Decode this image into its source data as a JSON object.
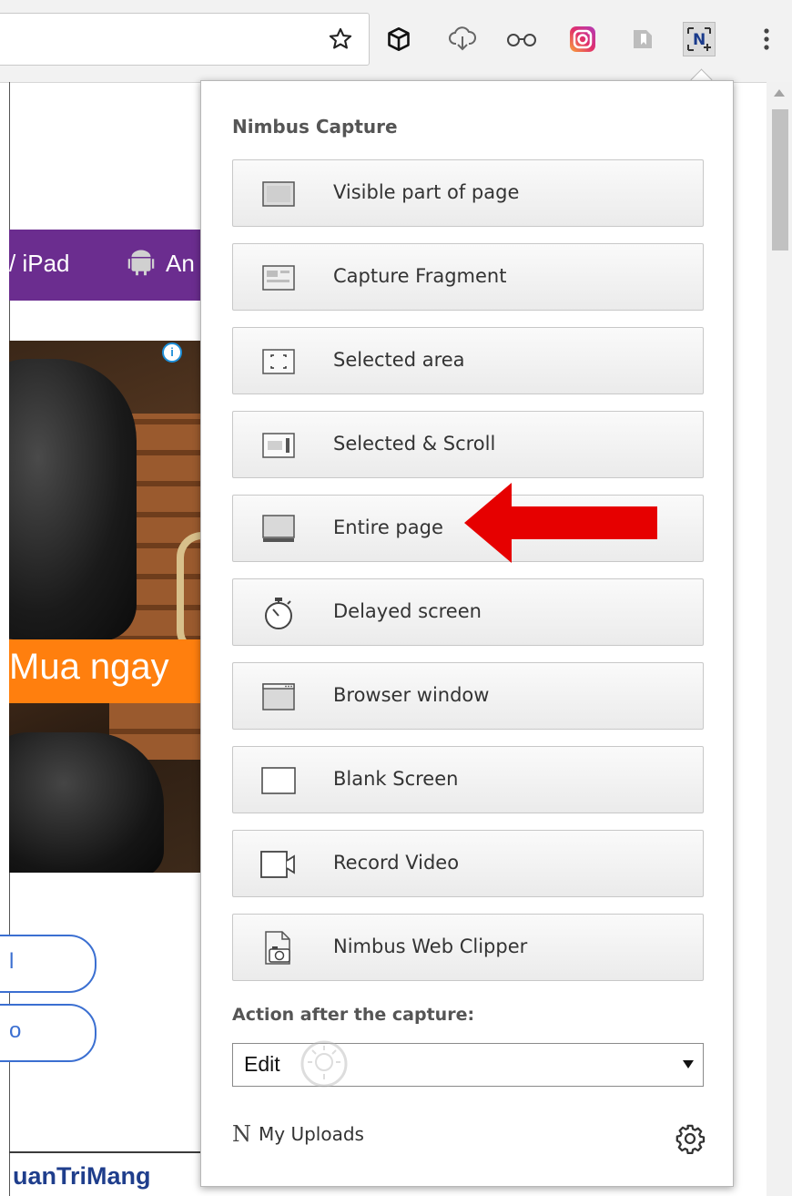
{
  "browser": {
    "toolbar_icons": [
      "star-icon",
      "cube-extension-icon",
      "cloud-download-icon",
      "glasses-icon",
      "instagram-icon",
      "bookmark-extension-icon",
      "nimbus-extension-icon",
      "menu-dots-icon"
    ]
  },
  "page": {
    "nav_text_1": "/ iPad",
    "nav_text_2": "An",
    "ad_banner": "Mua ngay",
    "pill_1": "l",
    "pill_2": "o",
    "brand": "uanTriMang"
  },
  "popup": {
    "title": "Nimbus Capture",
    "buttons": [
      {
        "label": "Visible part of page",
        "icon": "visible-part-icon"
      },
      {
        "label": "Capture Fragment",
        "icon": "fragment-icon"
      },
      {
        "label": "Selected area",
        "icon": "selected-area-icon"
      },
      {
        "label": "Selected & Scroll",
        "icon": "selected-scroll-icon"
      },
      {
        "label": "Entire page",
        "icon": "entire-page-icon"
      },
      {
        "label": "Delayed screen",
        "icon": "stopwatch-icon"
      },
      {
        "label": "Browser window",
        "icon": "browser-window-icon"
      },
      {
        "label": "Blank Screen",
        "icon": "blank-screen-icon"
      },
      {
        "label": "Record Video",
        "icon": "video-camera-icon"
      },
      {
        "label": "Nimbus Web Clipper",
        "icon": "web-clipper-icon"
      }
    ],
    "action_label": "Action after the capture:",
    "action_select": "Edit",
    "uploads_label": "My Uploads"
  },
  "colors": {
    "nav_purple": "#6b2d8f",
    "banner_orange": "#ff7f0e",
    "arrow_red": "#e60000",
    "brand_blue": "#1f3e8c"
  }
}
